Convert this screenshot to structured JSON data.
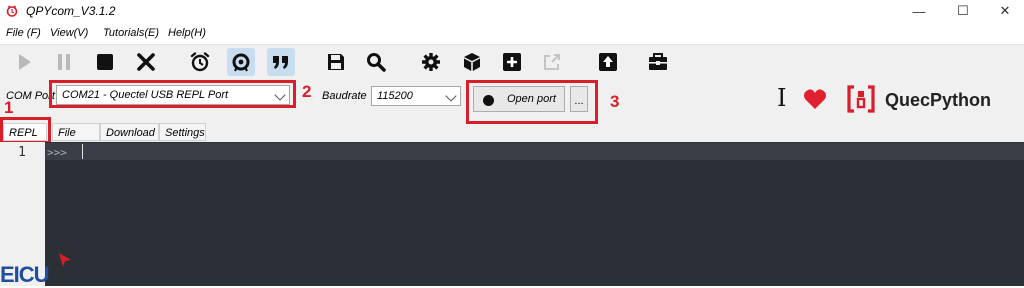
{
  "window": {
    "title": "QPYcom_V3.1.2",
    "minimize": "—",
    "maximize": "☐",
    "close": "✕"
  },
  "menu": {
    "file": "File (F)",
    "view": "View(V)",
    "tutorials": "Tutorials(E)",
    "help": "Help(H)"
  },
  "toolbar": {
    "icons": [
      "play-icon",
      "pause-icon",
      "stop-icon",
      "close-x-icon",
      "alarm-clock-icon",
      "refresh-icon",
      "quote-icon",
      "save-icon",
      "search-icon",
      "gear-icon",
      "cube-icon",
      "add-icon",
      "external-link-icon",
      "upload-icon",
      "toolbox-icon"
    ]
  },
  "port": {
    "com_label": "COM Port",
    "com_value": "COM21 - Quectel USB REPL Port",
    "baud_label": "Baudrate",
    "baud_value": "115200",
    "open_label": "Open port",
    "more_label": "..."
  },
  "annotations": {
    "n1": "1",
    "n2": "2",
    "n3": "3"
  },
  "tabs": [
    "REPL",
    "File",
    "Download",
    "Settings"
  ],
  "brand": {
    "name": "QuecPython",
    "cursor_symbol": "I",
    "heart_color": "#e0202e",
    "logo_color": "#d81e2b"
  },
  "editor": {
    "line_number": "1",
    "prompt": ">>>"
  },
  "watermark": "EICU"
}
